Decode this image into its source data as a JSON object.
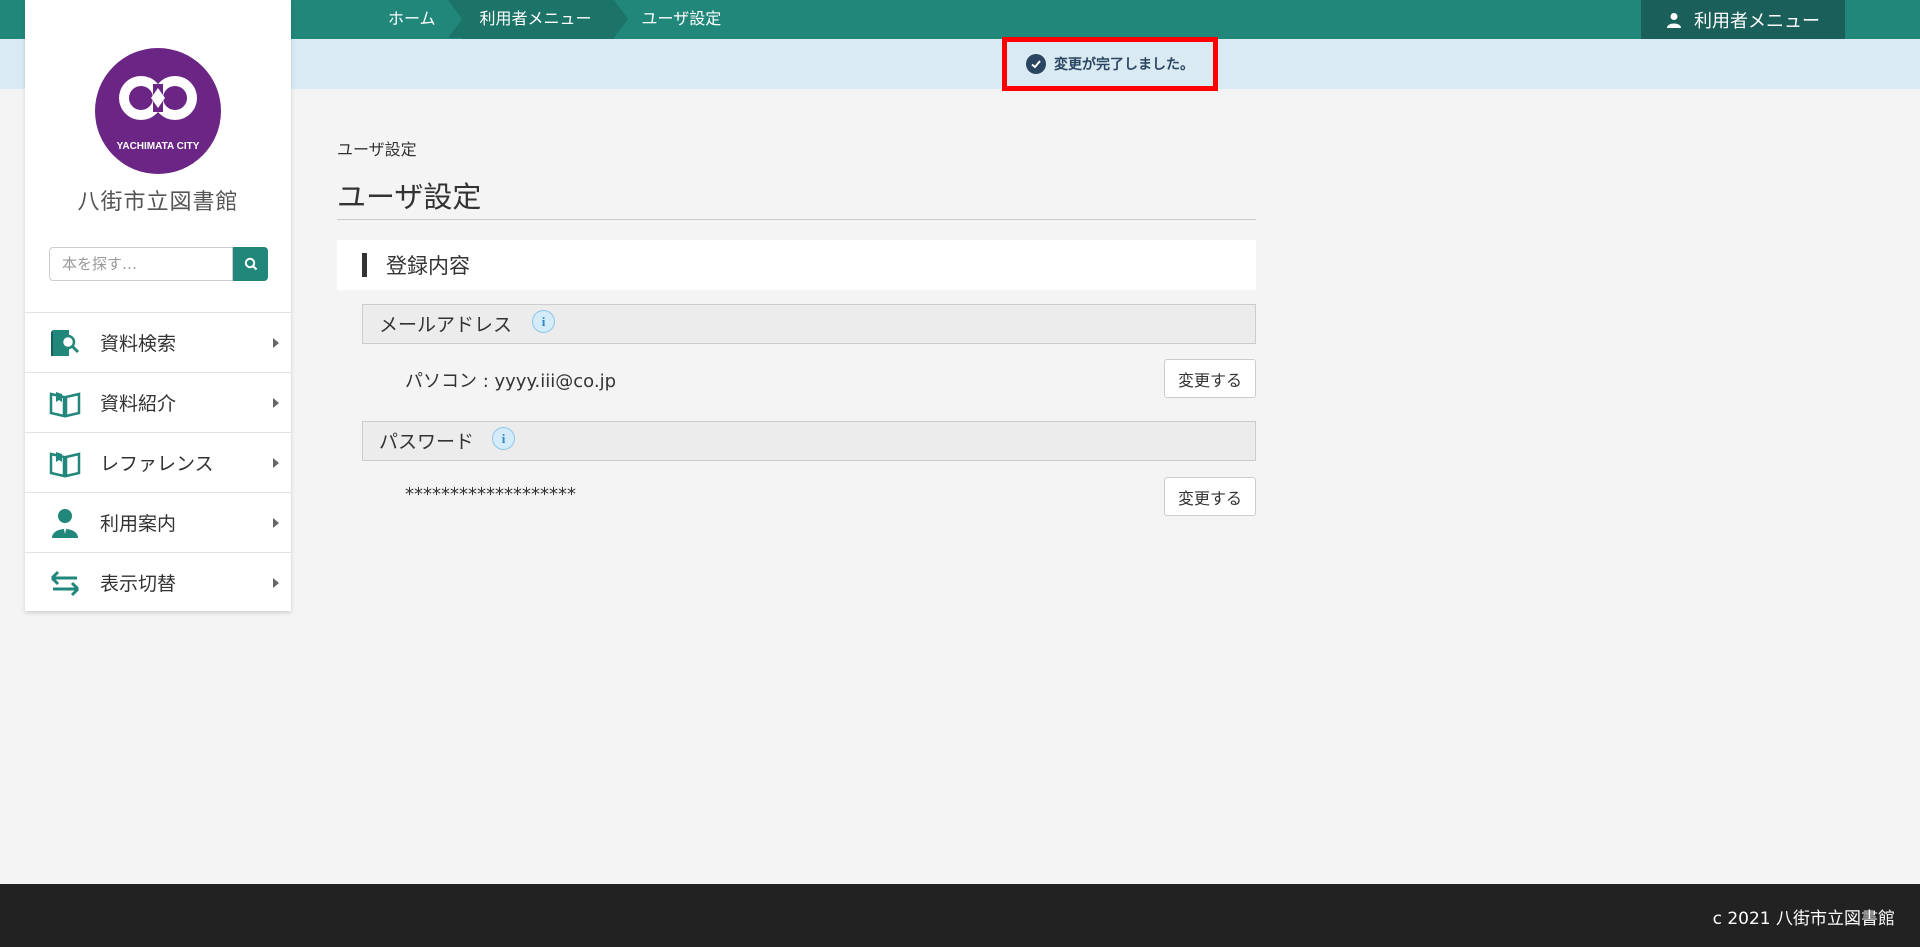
{
  "breadcrumb": {
    "items": [
      "ホーム",
      "利用者メニュー",
      "ユーザ設定"
    ]
  },
  "header": {
    "user_menu_label": "利用者メニュー"
  },
  "notice": {
    "message": "変更が完了しました。"
  },
  "sidebar": {
    "logo_text": "YACHIMATA CITY",
    "library_name": "八街市立図書館",
    "search_placeholder": "本を探す…",
    "items": [
      {
        "label": "資料検索",
        "icon": "book-search-icon"
      },
      {
        "label": "資料紹介",
        "icon": "open-book-icon"
      },
      {
        "label": "レファレンス",
        "icon": "open-book-icon"
      },
      {
        "label": "利用案内",
        "icon": "person-icon"
      },
      {
        "label": "表示切替",
        "icon": "switch-arrows-icon"
      }
    ]
  },
  "main": {
    "breadcrumb": "ユーザ設定",
    "title": "ユーザ設定",
    "section_title": "登録内容",
    "email": {
      "label": "メールアドレス",
      "value": "パソコン : yyyy.iii@co.jp",
      "button": "変更する"
    },
    "password": {
      "label": "パスワード",
      "value": "*******************",
      "button": "変更する"
    }
  },
  "footer": {
    "copyright": "c 2021 八街市立図書館"
  },
  "colors": {
    "brand": "#22877b",
    "brand_dark": "#1a5f5a",
    "notice_bg": "#daeaf3",
    "highlight": "#ff0000",
    "logo": "#6b2585"
  }
}
